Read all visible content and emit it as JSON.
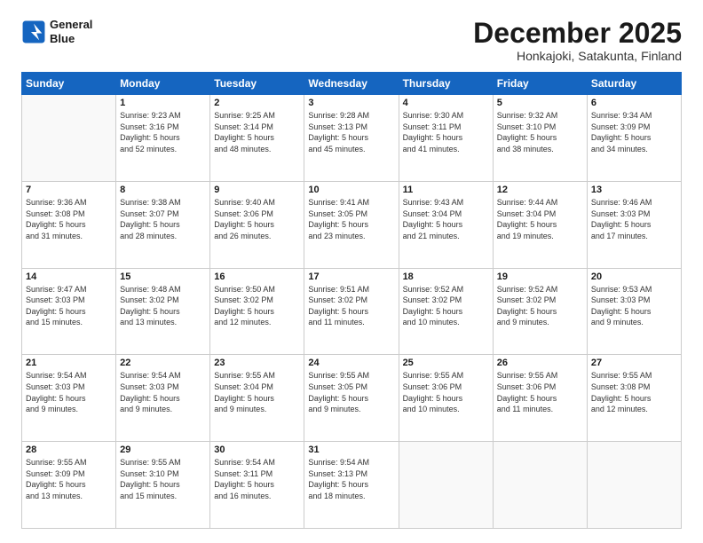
{
  "logo": {
    "line1": "General",
    "line2": "Blue"
  },
  "title": "December 2025",
  "subtitle": "Honkajoki, Satakunta, Finland",
  "header_days": [
    "Sunday",
    "Monday",
    "Tuesday",
    "Wednesday",
    "Thursday",
    "Friday",
    "Saturday"
  ],
  "weeks": [
    [
      {
        "day": "",
        "info": ""
      },
      {
        "day": "1",
        "info": "Sunrise: 9:23 AM\nSunset: 3:16 PM\nDaylight: 5 hours\nand 52 minutes."
      },
      {
        "day": "2",
        "info": "Sunrise: 9:25 AM\nSunset: 3:14 PM\nDaylight: 5 hours\nand 48 minutes."
      },
      {
        "day": "3",
        "info": "Sunrise: 9:28 AM\nSunset: 3:13 PM\nDaylight: 5 hours\nand 45 minutes."
      },
      {
        "day": "4",
        "info": "Sunrise: 9:30 AM\nSunset: 3:11 PM\nDaylight: 5 hours\nand 41 minutes."
      },
      {
        "day": "5",
        "info": "Sunrise: 9:32 AM\nSunset: 3:10 PM\nDaylight: 5 hours\nand 38 minutes."
      },
      {
        "day": "6",
        "info": "Sunrise: 9:34 AM\nSunset: 3:09 PM\nDaylight: 5 hours\nand 34 minutes."
      }
    ],
    [
      {
        "day": "7",
        "info": "Sunrise: 9:36 AM\nSunset: 3:08 PM\nDaylight: 5 hours\nand 31 minutes."
      },
      {
        "day": "8",
        "info": "Sunrise: 9:38 AM\nSunset: 3:07 PM\nDaylight: 5 hours\nand 28 minutes."
      },
      {
        "day": "9",
        "info": "Sunrise: 9:40 AM\nSunset: 3:06 PM\nDaylight: 5 hours\nand 26 minutes."
      },
      {
        "day": "10",
        "info": "Sunrise: 9:41 AM\nSunset: 3:05 PM\nDaylight: 5 hours\nand 23 minutes."
      },
      {
        "day": "11",
        "info": "Sunrise: 9:43 AM\nSunset: 3:04 PM\nDaylight: 5 hours\nand 21 minutes."
      },
      {
        "day": "12",
        "info": "Sunrise: 9:44 AM\nSunset: 3:04 PM\nDaylight: 5 hours\nand 19 minutes."
      },
      {
        "day": "13",
        "info": "Sunrise: 9:46 AM\nSunset: 3:03 PM\nDaylight: 5 hours\nand 17 minutes."
      }
    ],
    [
      {
        "day": "14",
        "info": "Sunrise: 9:47 AM\nSunset: 3:03 PM\nDaylight: 5 hours\nand 15 minutes."
      },
      {
        "day": "15",
        "info": "Sunrise: 9:48 AM\nSunset: 3:02 PM\nDaylight: 5 hours\nand 13 minutes."
      },
      {
        "day": "16",
        "info": "Sunrise: 9:50 AM\nSunset: 3:02 PM\nDaylight: 5 hours\nand 12 minutes."
      },
      {
        "day": "17",
        "info": "Sunrise: 9:51 AM\nSunset: 3:02 PM\nDaylight: 5 hours\nand 11 minutes."
      },
      {
        "day": "18",
        "info": "Sunrise: 9:52 AM\nSunset: 3:02 PM\nDaylight: 5 hours\nand 10 minutes."
      },
      {
        "day": "19",
        "info": "Sunrise: 9:52 AM\nSunset: 3:02 PM\nDaylight: 5 hours\nand 9 minutes."
      },
      {
        "day": "20",
        "info": "Sunrise: 9:53 AM\nSunset: 3:03 PM\nDaylight: 5 hours\nand 9 minutes."
      }
    ],
    [
      {
        "day": "21",
        "info": "Sunrise: 9:54 AM\nSunset: 3:03 PM\nDaylight: 5 hours\nand 9 minutes."
      },
      {
        "day": "22",
        "info": "Sunrise: 9:54 AM\nSunset: 3:03 PM\nDaylight: 5 hours\nand 9 minutes."
      },
      {
        "day": "23",
        "info": "Sunrise: 9:55 AM\nSunset: 3:04 PM\nDaylight: 5 hours\nand 9 minutes."
      },
      {
        "day": "24",
        "info": "Sunrise: 9:55 AM\nSunset: 3:05 PM\nDaylight: 5 hours\nand 9 minutes."
      },
      {
        "day": "25",
        "info": "Sunrise: 9:55 AM\nSunset: 3:06 PM\nDaylight: 5 hours\nand 10 minutes."
      },
      {
        "day": "26",
        "info": "Sunrise: 9:55 AM\nSunset: 3:06 PM\nDaylight: 5 hours\nand 11 minutes."
      },
      {
        "day": "27",
        "info": "Sunrise: 9:55 AM\nSunset: 3:08 PM\nDaylight: 5 hours\nand 12 minutes."
      }
    ],
    [
      {
        "day": "28",
        "info": "Sunrise: 9:55 AM\nSunset: 3:09 PM\nDaylight: 5 hours\nand 13 minutes."
      },
      {
        "day": "29",
        "info": "Sunrise: 9:55 AM\nSunset: 3:10 PM\nDaylight: 5 hours\nand 15 minutes."
      },
      {
        "day": "30",
        "info": "Sunrise: 9:54 AM\nSunset: 3:11 PM\nDaylight: 5 hours\nand 16 minutes."
      },
      {
        "day": "31",
        "info": "Sunrise: 9:54 AM\nSunset: 3:13 PM\nDaylight: 5 hours\nand 18 minutes."
      },
      {
        "day": "",
        "info": ""
      },
      {
        "day": "",
        "info": ""
      },
      {
        "day": "",
        "info": ""
      }
    ]
  ]
}
